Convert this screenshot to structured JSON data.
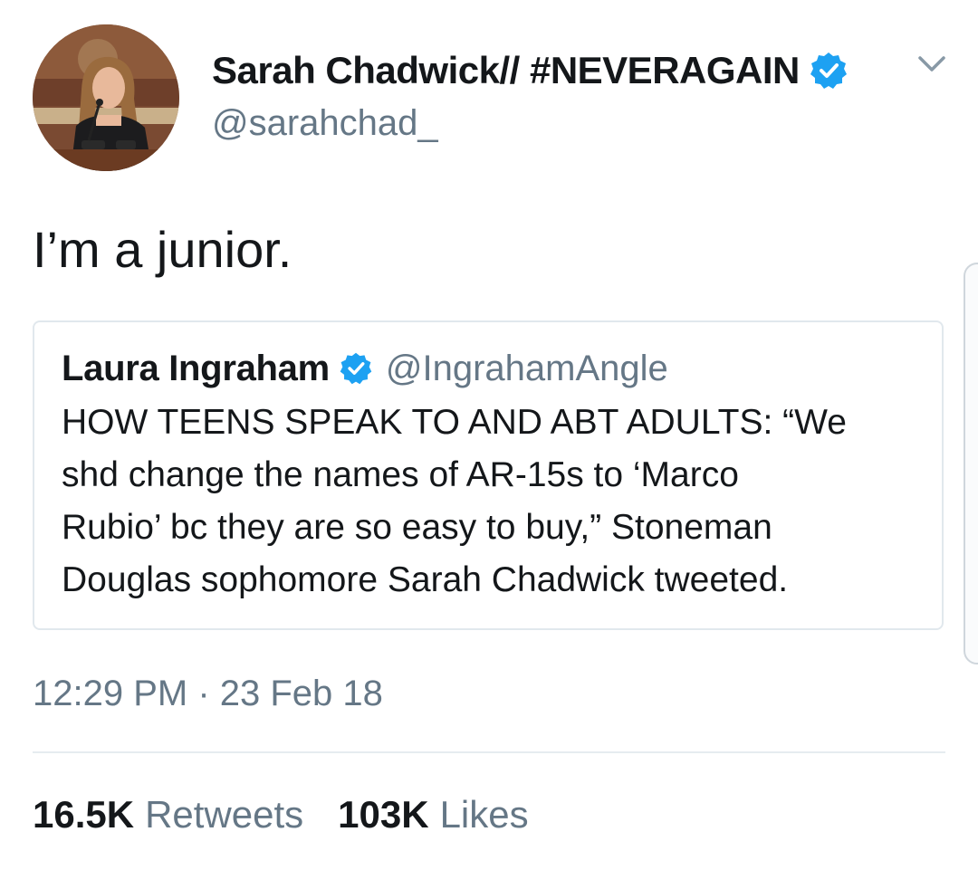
{
  "author": {
    "name": "Sarah Chadwick// #NEVERAGAIN",
    "handle": "@sarahchad_",
    "verified": true,
    "avatar": "profile-photo"
  },
  "tweet": {
    "text": "I’m a junior."
  },
  "quoted_tweet": {
    "name": "Laura Ingraham",
    "handle": "@IngrahamAngle",
    "verified": true,
    "lines": [
      "HOW TEENS SPEAK TO AND ABT ADULTS: “We",
      "shd change the names of AR-15s to ‘Marco",
      "Rubio’ bc they are so easy to buy,” Stoneman",
      "Douglas sophomore Sarah Chadwick tweeted."
    ]
  },
  "timestamp": "12:29 PM · 23 Feb 18",
  "stats": {
    "retweets_count": "16.5K",
    "retweets_label": "Retweets",
    "likes_count": "103K",
    "likes_label": "Likes"
  },
  "colors": {
    "text_primary": "#14171a",
    "text_secondary": "#657786",
    "verified_blue": "#1da1f2",
    "border": "#e1e8ed"
  },
  "icons": {
    "verified": "verified-badge-icon",
    "menu": "chevron-down-icon"
  }
}
